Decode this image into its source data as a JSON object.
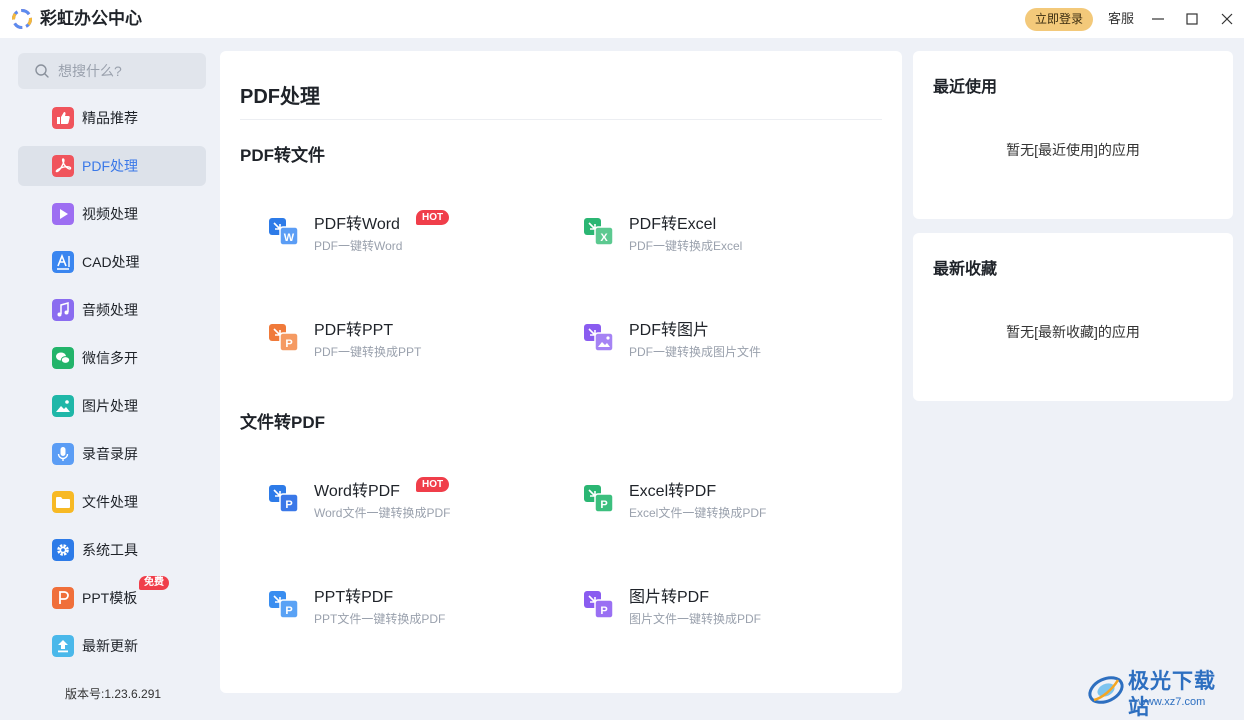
{
  "app": {
    "title": "彩虹办公中心",
    "login_label": "立即登录",
    "service_label": "客服",
    "version": "版本号:1.23.6.291"
  },
  "search": {
    "placeholder": "想搜什么?"
  },
  "sidebar": {
    "items": [
      {
        "label": "精品推荐",
        "icon": "thumbs-up-icon",
        "color": "#f0545c"
      },
      {
        "label": "PDF处理",
        "icon": "pdf-icon",
        "color": "#f0545c",
        "active": true
      },
      {
        "label": "视频处理",
        "icon": "play-icon",
        "color": "#9d6ef2"
      },
      {
        "label": "CAD处理",
        "icon": "cad-icon",
        "color": "#3a86f0"
      },
      {
        "label": "音频处理",
        "icon": "music-icon",
        "color": "#8a6cf0"
      },
      {
        "label": "微信多开",
        "icon": "wechat-icon",
        "color": "#22b46a"
      },
      {
        "label": "图片处理",
        "icon": "image-icon",
        "color": "#1fb7a8"
      },
      {
        "label": "录音录屏",
        "icon": "microphone-icon",
        "color": "#5b9df5"
      },
      {
        "label": "文件处理",
        "icon": "folder-icon",
        "color": "#f7b924"
      },
      {
        "label": "系统工具",
        "icon": "gear-icon",
        "color": "#2d7be8"
      },
      {
        "label": "PPT模板",
        "icon": "ppt-icon",
        "color": "#f06f3a",
        "badge": "免费"
      },
      {
        "label": "最新更新",
        "icon": "upload-icon",
        "color": "#4ab8ea"
      }
    ]
  },
  "main": {
    "title": "PDF处理",
    "sections": [
      {
        "title": "PDF转文件",
        "tools": [
          {
            "name": "PDF转Word",
            "desc": "PDF一键转Word",
            "badge": "HOT",
            "icon": "pdf-to-word-icon",
            "color": "#2d7be8",
            "letter": "W"
          },
          {
            "name": "PDF转Excel",
            "desc": "PDF一键转换成Excel",
            "icon": "pdf-to-excel-icon",
            "color": "#2bb673",
            "letter": "X"
          },
          {
            "name": "PDF转PPT",
            "desc": "PDF一键转换成PPT",
            "icon": "pdf-to-ppt-icon",
            "color": "#f07a3a",
            "letter": "P"
          },
          {
            "name": "PDF转图片",
            "desc": "PDF一键转换成图片文件",
            "icon": "pdf-to-image-icon",
            "color": "#8a5cf0",
            "letter": "img"
          }
        ]
      },
      {
        "title": "文件转PDF",
        "tools": [
          {
            "name": "Word转PDF",
            "desc": "Word文件一键转换成PDF",
            "badge": "HOT",
            "icon": "word-to-pdf-icon",
            "color": "#2d7be8",
            "letter": "P"
          },
          {
            "name": "Excel转PDF",
            "desc": "Excel文件一键转换成PDF",
            "icon": "excel-to-pdf-icon",
            "color": "#2bb673",
            "letter": "P"
          },
          {
            "name": "PPT转PDF",
            "desc": "PPT文件一键转换成PDF",
            "icon": "ppt-to-pdf-icon",
            "color": "#3a8ef0",
            "letter": "P"
          },
          {
            "name": "图片转PDF",
            "desc": "图片文件一键转换成PDF",
            "icon": "image-to-pdf-icon",
            "color": "#8a5cf0",
            "letter": "P"
          }
        ]
      }
    ]
  },
  "recent": {
    "title": "最近使用",
    "empty": "暂无[最近使用]的应用"
  },
  "favorites": {
    "title": "最新收藏",
    "empty": "暂无[最新收藏]的应用"
  },
  "watermark": {
    "text": "极光下载站",
    "url": "www.xz7.com"
  }
}
